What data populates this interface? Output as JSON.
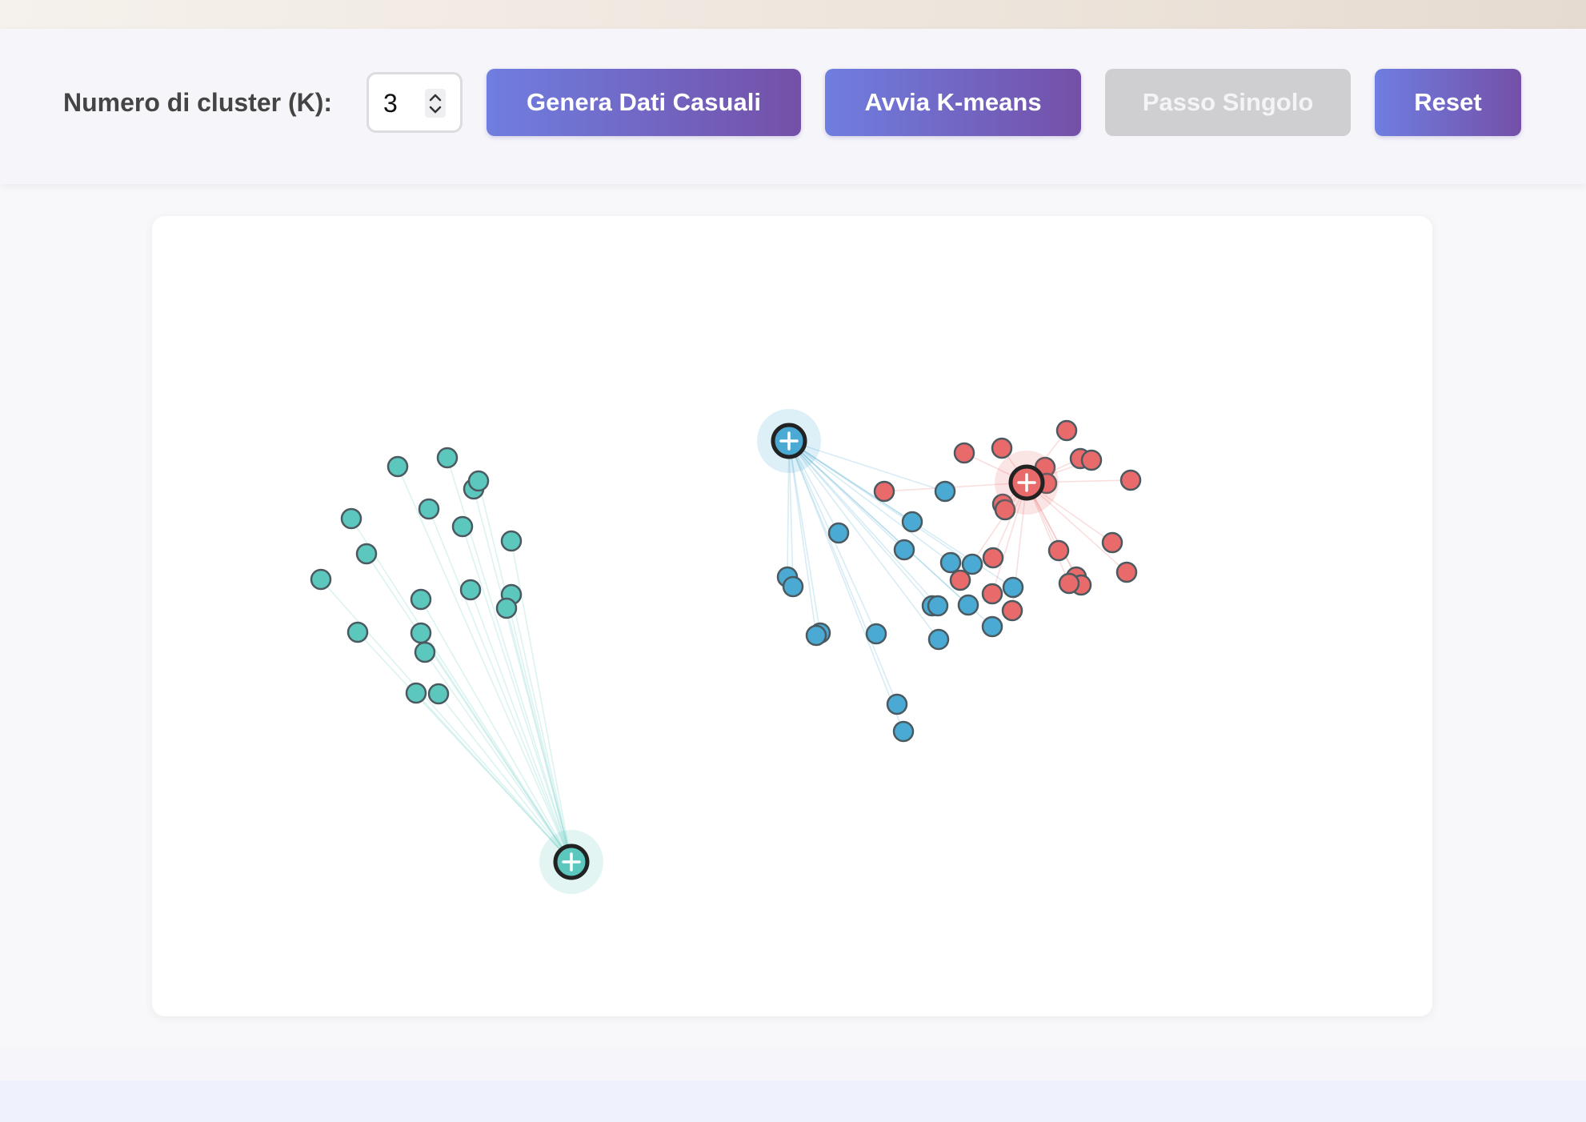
{
  "controls": {
    "k_label": "Numero di cluster (K):",
    "k_value": "3",
    "generate_label": "Genera Dati Casuali",
    "run_label": "Avvia K-means",
    "step_label": "Passo Singolo",
    "reset_label": "Reset",
    "step_enabled": false
  },
  "colors": {
    "accent_start": "#6f7ee0",
    "accent_end": "#7450a8",
    "disabled": "#cfcfd2",
    "cluster_teal": "#5cc8bd",
    "cluster_blue": "#4aaad3",
    "cluster_red": "#e86a6a"
  },
  "clusters": [
    {
      "id": "teal",
      "color": "#5cc8bd",
      "centroid": [
        714,
        1077
      ],
      "points": [
        [
          497,
          583
        ],
        [
          559,
          572
        ],
        [
          592,
          611
        ],
        [
          598,
          601
        ],
        [
          439,
          648
        ],
        [
          536,
          636
        ],
        [
          578,
          658
        ],
        [
          639,
          676
        ],
        [
          458,
          692
        ],
        [
          401,
          724
        ],
        [
          526,
          749
        ],
        [
          588,
          737
        ],
        [
          639,
          743
        ],
        [
          633,
          760
        ],
        [
          447,
          790
        ],
        [
          526,
          791
        ],
        [
          531,
          815
        ],
        [
          520,
          866
        ],
        [
          548,
          867
        ]
      ]
    },
    {
      "id": "blue",
      "color": "#4aaad3",
      "centroid": [
        986,
        551
      ],
      "points": [
        [
          1181,
          614
        ],
        [
          1140,
          652
        ],
        [
          1048,
          666
        ],
        [
          1130,
          687
        ],
        [
          1188,
          703
        ],
        [
          1215,
          705
        ],
        [
          984,
          721
        ],
        [
          991,
          733
        ],
        [
          1266,
          734
        ],
        [
          1165,
          757
        ],
        [
          1172,
          757
        ],
        [
          1210,
          756
        ],
        [
          1240,
          783
        ],
        [
          1173,
          799
        ],
        [
          1095,
          792
        ],
        [
          1025,
          791
        ],
        [
          1020,
          794
        ],
        [
          1121,
          880
        ],
        [
          1129,
          914
        ]
      ]
    },
    {
      "id": "red",
      "color": "#e86a6a",
      "centroid": [
        1283,
        603
      ],
      "points": [
        [
          1205,
          566
        ],
        [
          1252,
          560
        ],
        [
          1333,
          538
        ],
        [
          1350,
          573
        ],
        [
          1364,
          575
        ],
        [
          1306,
          584
        ],
        [
          1413,
          600
        ],
        [
          1308,
          604
        ],
        [
          1105,
          614
        ],
        [
          1253,
          630
        ],
        [
          1256,
          637
        ],
        [
          1390,
          678
        ],
        [
          1323,
          688
        ],
        [
          1241,
          697
        ],
        [
          1200,
          725
        ],
        [
          1345,
          721
        ],
        [
          1351,
          731
        ],
        [
          1336,
          729
        ],
        [
          1408,
          715
        ],
        [
          1240,
          742
        ],
        [
          1265,
          763
        ]
      ]
    }
  ]
}
